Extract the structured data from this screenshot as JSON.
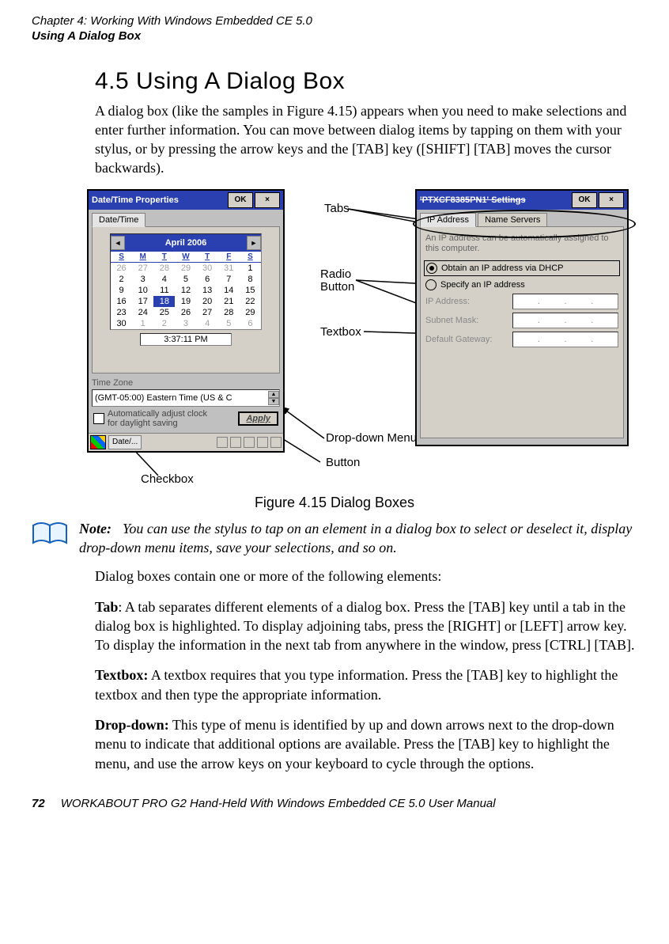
{
  "header": {
    "chapter_line": "Chapter 4: Working With Windows Embedded CE 5.0",
    "section_line": "Using A Dialog Box"
  },
  "section": {
    "number_title": "4.5  Using A Dialog Box",
    "intro": "A dialog box (like the samples in Figure 4.15) appears when you need to make selections and enter further information. You can move between dialog items by tapping on them with your stylus, or by pressing the arrow keys and the [TAB] key ([SHIFT] [TAB] moves the cursor backwards)."
  },
  "annotations": {
    "tabs": "Tabs",
    "radio": "Radio Button",
    "textbox": "Textbox",
    "dropdown": "Drop-down Menu",
    "button": "Button",
    "checkbox": "Checkbox"
  },
  "left_device": {
    "title": "Date/Time Properties",
    "ok": "OK",
    "tab_label": "Date/Time",
    "month": "April 2006",
    "dow": [
      "S",
      "M",
      "T",
      "W",
      "T",
      "F",
      "S"
    ],
    "weeks": [
      {
        "cells": [
          {
            "v": "26",
            "g": true
          },
          {
            "v": "27",
            "g": true
          },
          {
            "v": "28",
            "g": true
          },
          {
            "v": "29",
            "g": true
          },
          {
            "v": "30",
            "g": true
          },
          {
            "v": "31",
            "g": true
          },
          {
            "v": "1"
          }
        ]
      },
      {
        "cells": [
          {
            "v": "2"
          },
          {
            "v": "3"
          },
          {
            "v": "4"
          },
          {
            "v": "5"
          },
          {
            "v": "6"
          },
          {
            "v": "7"
          },
          {
            "v": "8"
          }
        ]
      },
      {
        "cells": [
          {
            "v": "9"
          },
          {
            "v": "10"
          },
          {
            "v": "11"
          },
          {
            "v": "12"
          },
          {
            "v": "13"
          },
          {
            "v": "14"
          },
          {
            "v": "15"
          }
        ]
      },
      {
        "cells": [
          {
            "v": "16"
          },
          {
            "v": "17"
          },
          {
            "v": "18",
            "t": true
          },
          {
            "v": "19"
          },
          {
            "v": "20"
          },
          {
            "v": "21"
          },
          {
            "v": "22"
          }
        ]
      },
      {
        "cells": [
          {
            "v": "23"
          },
          {
            "v": "24"
          },
          {
            "v": "25"
          },
          {
            "v": "26"
          },
          {
            "v": "27"
          },
          {
            "v": "28"
          },
          {
            "v": "29"
          }
        ]
      },
      {
        "cells": [
          {
            "v": "30"
          },
          {
            "v": "1",
            "g": true
          },
          {
            "v": "2",
            "g": true
          },
          {
            "v": "3",
            "g": true
          },
          {
            "v": "4",
            "g": true
          },
          {
            "v": "5",
            "g": true
          },
          {
            "v": "6",
            "g": true
          }
        ]
      }
    ],
    "time": "3:37:11 PM",
    "timezone_label": "Time Zone",
    "timezone_value": "(GMT-05:00) Eastern Time (US & C",
    "dst_label": "Automatically adjust clock for daylight saving",
    "apply": "Apply",
    "taskbtn": "Date/..."
  },
  "right_device": {
    "title": "'PTXCF8385PN1' Settings",
    "ok": "OK",
    "tabs": [
      "IP Address",
      "Name Servers"
    ],
    "msg": "An IP address can be automatically assigned to this computer.",
    "radio1": "Obtain an IP address via DHCP",
    "radio2": "Specify an IP address",
    "fields": [
      "IP Address:",
      "Subnet Mask:",
      "Default Gateway:"
    ]
  },
  "figure_caption": "Figure 4.15 Dialog Boxes",
  "note": {
    "label": "Note:",
    "text": "You can use the stylus to tap on an element in a dialog box to select or deselect it, display drop-down menu items, save your selections, and so on."
  },
  "paragraphs": {
    "intro2": "Dialog boxes contain one or more of the following elements:",
    "tab": "Tab: A tab separates different elements of a dialog box. Press the [TAB] key until a tab in the dialog box is highlighted. To display adjoining tabs, press the [RIGHT] or [LEFT] arrow key. To display the information in the next tab from anywhere in the window, press [CTRL] [TAB].",
    "textbox": "Textbox: A textbox requires that you type information. Press the [TAB] key to highlight the textbox and then type the appropriate information.",
    "dropdown": "Drop-down: This type of menu is identified by up and down arrows next to the drop-down menu to indicate that additional options are available. Press the [TAB] key to highlight the menu, and use the arrow keys on your keyboard to cycle through the options."
  },
  "footer": {
    "page": "72",
    "book": "WORKABOUT PRO G2 Hand-Held With Windows Embedded CE 5.0 User Manual"
  }
}
